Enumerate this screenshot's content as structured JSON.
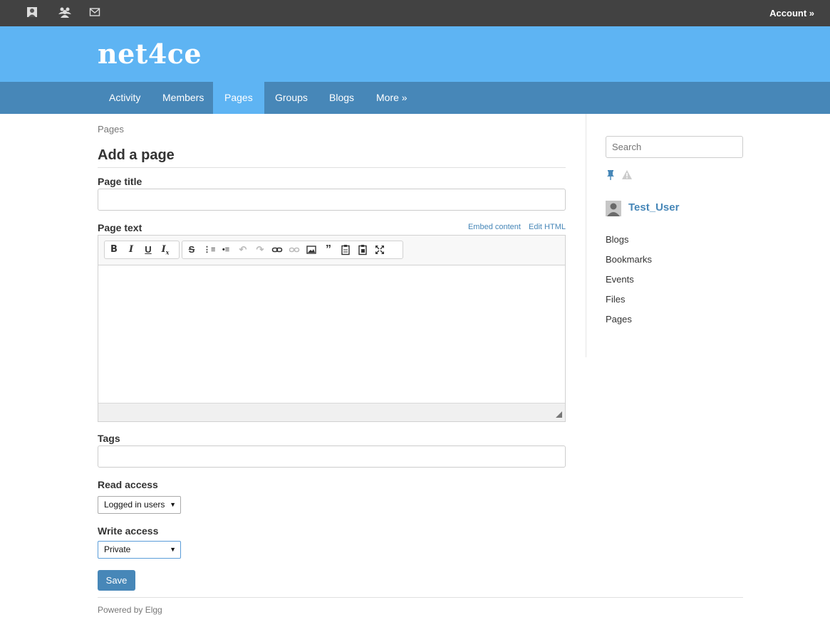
{
  "topbar": {
    "icons": [
      "profile-icon",
      "friends-icon",
      "messages-icon"
    ],
    "account": "Account »"
  },
  "site": {
    "name": "net4ce"
  },
  "nav": {
    "items": [
      {
        "label": "Activity",
        "active": false
      },
      {
        "label": "Members",
        "active": false
      },
      {
        "label": "Pages",
        "active": true
      },
      {
        "label": "Groups",
        "active": false
      },
      {
        "label": "Blogs",
        "active": false
      },
      {
        "label": "More »",
        "active": false
      }
    ]
  },
  "main": {
    "breadcrumb": "Pages",
    "title": "Add a page",
    "page_title_label": "Page title",
    "page_title_value": "",
    "page_text_label": "Page text",
    "embed_content": "Embed content",
    "edit_html": "Edit HTML",
    "tags_label": "Tags",
    "tags_value": "",
    "read_access_label": "Read access",
    "read_access_value": "Logged in users",
    "write_access_label": "Write access",
    "write_access_value": "Private",
    "save_label": "Save"
  },
  "editor": {
    "toolbar": [
      "bold-icon",
      "italic-icon",
      "underline-icon",
      "remove-format-icon",
      "strikethrough-icon",
      "numbered-list-icon",
      "bulleted-list-icon",
      "undo-icon",
      "redo-icon",
      "link-icon",
      "unlink-icon",
      "image-icon",
      "blockquote-icon",
      "paste-text-icon",
      "paste-word-icon",
      "maximize-icon"
    ]
  },
  "sidebar": {
    "search_placeholder": "Search",
    "user_name": "Test_User",
    "links": [
      "Blogs",
      "Bookmarks",
      "Events",
      "Files",
      "Pages"
    ]
  },
  "footer": {
    "text": "Powered by Elgg"
  },
  "colors": {
    "topbar": "#424242",
    "header": "#5eb4f3",
    "nav": "#4787b8",
    "link": "#4787b8"
  }
}
